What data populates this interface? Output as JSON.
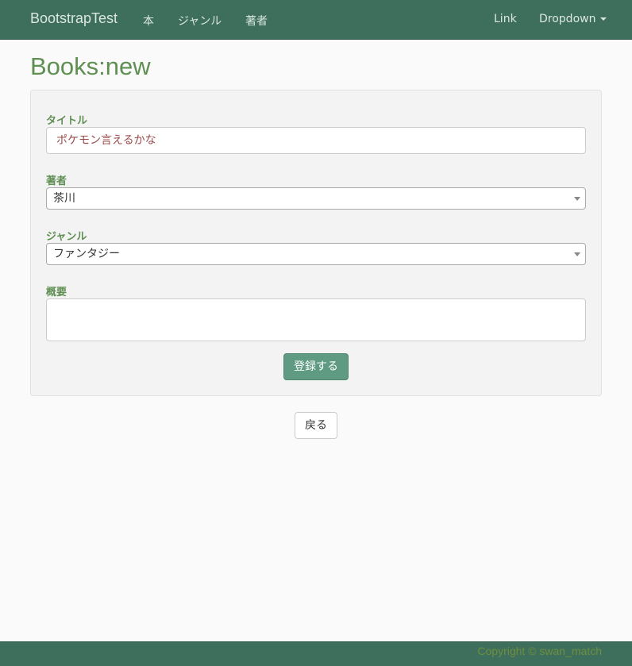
{
  "navbar": {
    "brand": "BootstrapTest",
    "links": [
      "本",
      "ジャンル",
      "著者"
    ],
    "right_link": "Link",
    "dropdown_label": "Dropdown"
  },
  "page": {
    "title": "Books:new"
  },
  "form": {
    "title_label": "タイトル",
    "title_value": "ポケモン言えるかな",
    "author_label": "著者",
    "author_selected": "茶川",
    "genre_label": "ジャンル",
    "genre_selected": "ファンタジー",
    "summary_label": "概要",
    "summary_value": "",
    "submit_label": "登録する"
  },
  "back_label": "戻る",
  "footer": {
    "copyright": "Copyright © swan_match"
  },
  "colors": {
    "navbar": "#3e6e5c",
    "accent_green": "#5f8f52",
    "submit_button": "#5f9a82",
    "input_text": "#9a4a4a"
  }
}
